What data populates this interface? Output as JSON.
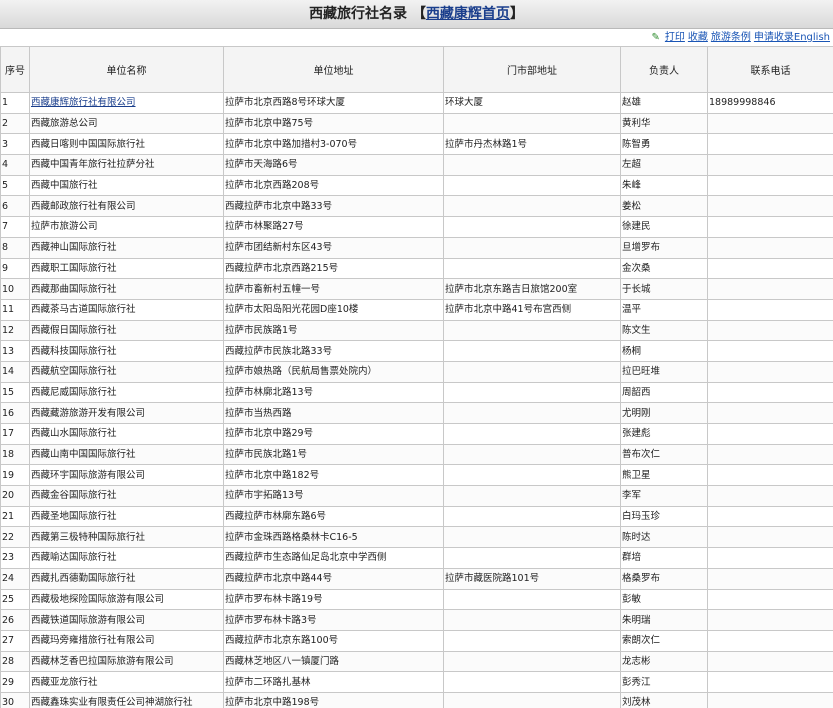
{
  "header": {
    "title": "西藏旅行社名录",
    "bracket_open": "【",
    "home_link": "西藏康辉首页",
    "bracket_close": "】"
  },
  "toolbar": {
    "pencil_icon": "pencil-icon",
    "links": [
      "打印",
      "收藏",
      "旅游条例",
      "申请收录English"
    ]
  },
  "table": {
    "columns": [
      "序号",
      "单位名称",
      "单位地址",
      "门市部地址",
      "负责人",
      "联系电话"
    ],
    "rows": [
      [
        "1",
        "西藏康辉旅行社有限公司",
        "拉萨市北京西路8号环球大厦",
        "环球大厦",
        "赵雄",
        "18989998846"
      ],
      [
        "2",
        "西藏旅游总公司",
        "拉萨市北京中路75号",
        "",
        "黄利华",
        ""
      ],
      [
        "3",
        "西藏日喀则中国国际旅行社",
        "拉萨市北京中路加措村3-070号",
        "拉萨市丹杰林路1号",
        "陈智勇",
        ""
      ],
      [
        "4",
        "西藏中国青年旅行社拉萨分社",
        "拉萨市天海路6号",
        "",
        "左超",
        ""
      ],
      [
        "5",
        "西藏中国旅行社",
        "拉萨市北京西路208号",
        "",
        "朱峰",
        ""
      ],
      [
        "6",
        "西藏邮政旅行社有限公司",
        "西藏拉萨市北京中路33号",
        "",
        "姜松",
        ""
      ],
      [
        "7",
        "拉萨市旅游公司",
        "拉萨市林聚路27号",
        "",
        "徐建民",
        ""
      ],
      [
        "8",
        "西藏神山国际旅行社",
        "拉萨市团结新村东区43号",
        "",
        "旦增罗布",
        ""
      ],
      [
        "9",
        "西藏职工国际旅行社",
        "西藏拉萨市北京西路215号",
        "",
        "金次桑",
        ""
      ],
      [
        "10",
        "西藏那曲国际旅行社",
        "拉萨市畜新村五幢一号",
        "拉萨市北京东路吉日旅馆200室",
        "于长城",
        ""
      ],
      [
        "11",
        "西藏茶马古道国际旅行社",
        "拉萨市太阳岛阳光花园D座10楼",
        "拉萨市北京中路41号布宫西侧",
        "温平",
        ""
      ],
      [
        "12",
        "西藏假日国际旅行社",
        "拉萨市民族路1号",
        "",
        "陈文生",
        ""
      ],
      [
        "13",
        "西藏科技国际旅行社",
        "西藏拉萨市民族北路33号",
        "",
        "杨桐",
        ""
      ],
      [
        "14",
        "西藏航空国际旅行社",
        "拉萨市娘热路（民航局售票处院内）",
        "",
        "拉巴旺堆",
        ""
      ],
      [
        "15",
        "西藏尼威国际旅行社",
        "拉萨市林廓北路13号",
        "",
        "周韶西",
        ""
      ],
      [
        "16",
        "西藏藏游旅游开发有限公司",
        "拉萨市当热西路",
        "",
        "尤明刚",
        ""
      ],
      [
        "17",
        "西藏山水国际旅行社",
        "拉萨市北京中路29号",
        "",
        "张建彪",
        ""
      ],
      [
        "18",
        "西藏山南中国国际旅行社",
        "拉萨市民族北路1号",
        "",
        "普布次仁",
        ""
      ],
      [
        "19",
        "西藏环宇国际旅游有限公司",
        "拉萨市北京中路182号",
        "",
        "熊卫星",
        ""
      ],
      [
        "20",
        "西藏金谷国际旅行社",
        "拉萨市宇拓路13号",
        "",
        "李军",
        ""
      ],
      [
        "21",
        "西藏圣地国际旅行社",
        "西藏拉萨市林廓东路6号",
        "",
        "白玛玉珍",
        ""
      ],
      [
        "22",
        "西藏第三极特种国际旅行社",
        "拉萨市金珠西路格桑林卡C16-5",
        "",
        "陈时达",
        ""
      ],
      [
        "23",
        "西藏喻达国际旅行社",
        "西藏拉萨市生态路仙足岛北京中学西侧",
        "",
        "群培",
        ""
      ],
      [
        "24",
        "西藏扎西德勤国际旅行社",
        "西藏拉萨市北京中路44号",
        "拉萨市藏医院路101号",
        "格桑罗布",
        ""
      ],
      [
        "25",
        "西藏极地探险国际旅游有限公司",
        "拉萨市罗布林卡路19号",
        "",
        "彭敏",
        ""
      ],
      [
        "26",
        "西藏铁道国际旅游有限公司",
        "拉萨市罗布林卡路3号",
        "",
        "朱明瑞",
        ""
      ],
      [
        "27",
        "西藏玛旁雍措旅行社有限公司",
        "西藏拉萨市北京东路100号",
        "",
        "索朗次仁",
        ""
      ],
      [
        "28",
        "西藏林芝香巴拉国际旅游有限公司",
        "西藏林芝地区八一镇厦门路",
        "",
        "龙志彬",
        ""
      ],
      [
        "29",
        "西藏亚龙旅行社",
        "拉萨市二环路扎基林",
        "",
        "彭秀江",
        ""
      ],
      [
        "30",
        "西藏鑫珠实业有限责任公司神湖旅行社",
        "拉萨市北京中路198号",
        "",
        "刘茂林",
        ""
      ]
    ]
  }
}
